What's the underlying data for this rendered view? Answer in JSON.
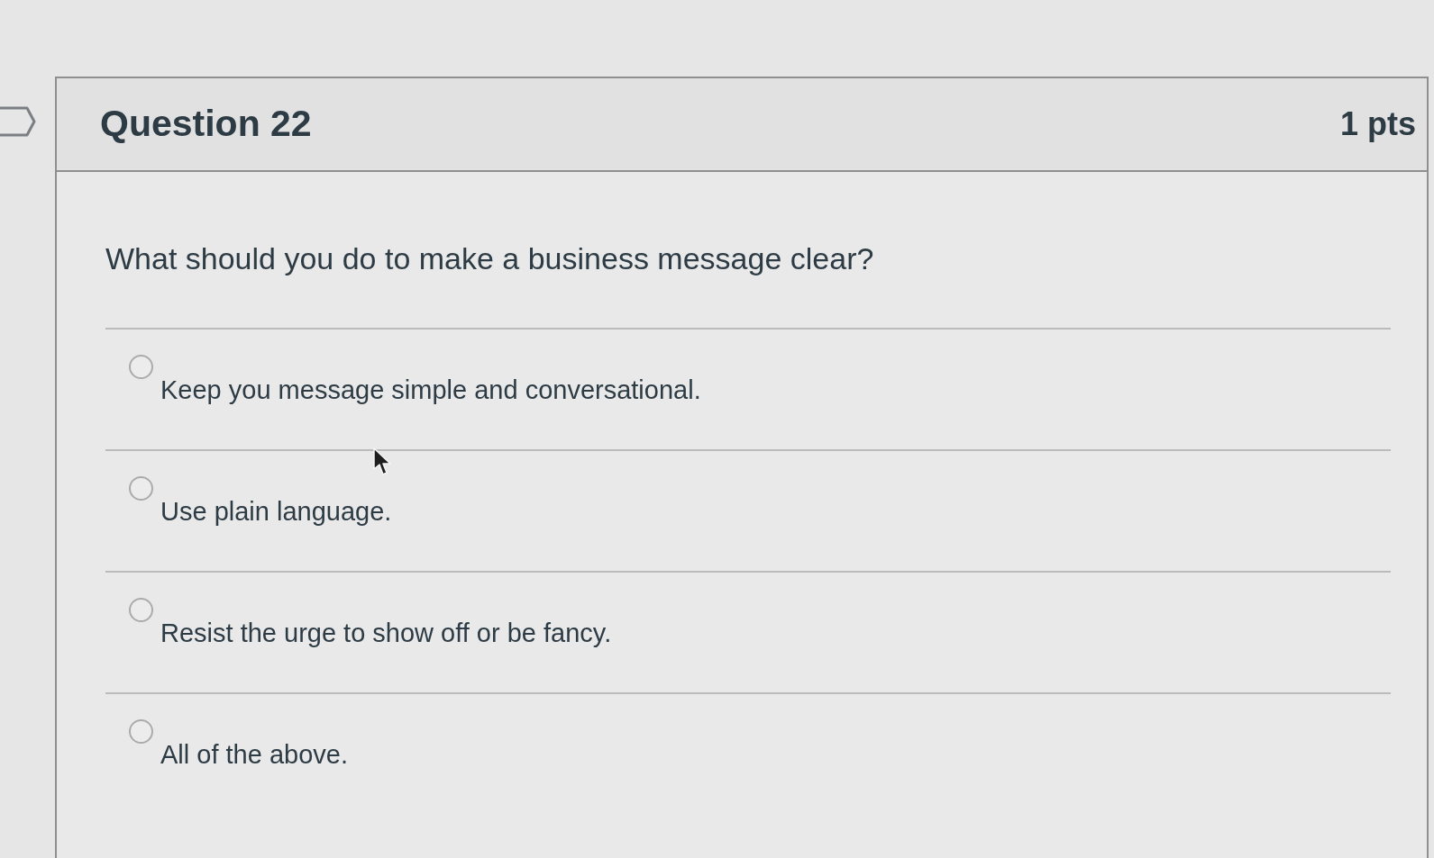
{
  "question": {
    "title": "Question 22",
    "points": "1 pts",
    "text": "What should you do to make a business message clear?",
    "answers": [
      {
        "label": "Keep you message simple and conversational.",
        "selected": false
      },
      {
        "label": "Use plain language.",
        "selected": false
      },
      {
        "label": "Resist the urge to show off or be fancy.",
        "selected": false
      },
      {
        "label": "All of the above.",
        "selected": false
      }
    ]
  }
}
